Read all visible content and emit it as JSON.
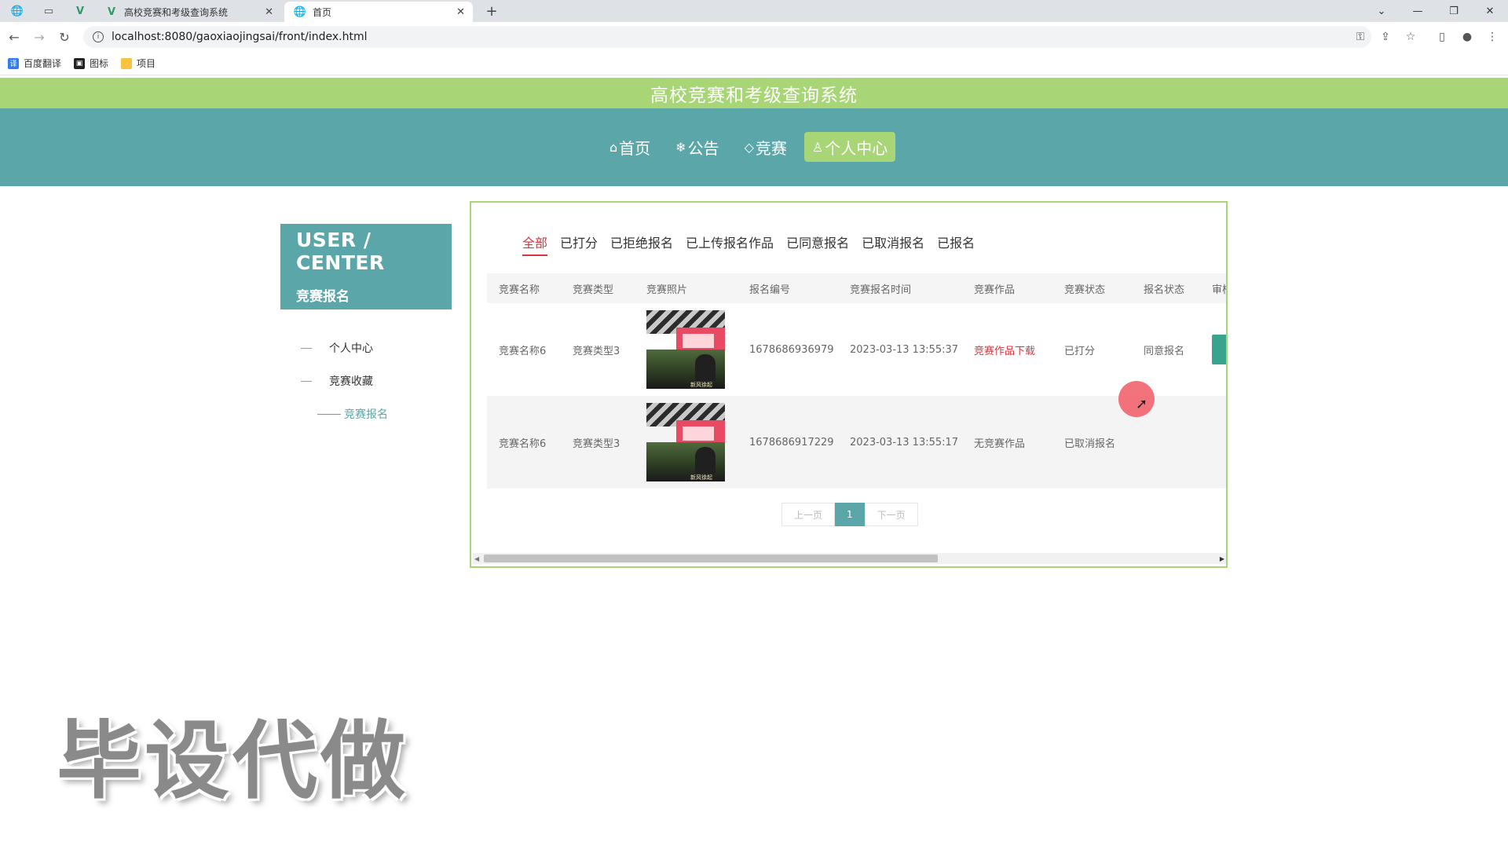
{
  "browser": {
    "tabs": [
      {
        "label": "高校竞赛和考级查询系统",
        "state": "inactive",
        "icon": "vue-logo-icon"
      },
      {
        "label": "首页",
        "state": "active",
        "icon": "globe-icon"
      }
    ],
    "url": "localhost:8080/gaoxiaojingsai/front/index.html",
    "bookmarks": [
      {
        "label": "百度翻译",
        "icon": "translate-icon",
        "color": "#2e7cf6"
      },
      {
        "label": "图标",
        "icon": "image-icon",
        "color": "#222222"
      },
      {
        "label": "项目",
        "icon": "folder-icon",
        "color": "#f6c342"
      }
    ],
    "tab_close_glyph": "✕",
    "new_tab_glyph": "+",
    "window_controls": [
      "⌄",
      "—",
      "❐",
      "✕"
    ]
  },
  "site": {
    "title": "高校竞赛和考级查询系统",
    "nav": [
      {
        "label": "首页",
        "icon": "home-icon",
        "glyph": "⌂",
        "active": false
      },
      {
        "label": "公告",
        "icon": "snowflake-icon",
        "glyph": "❄",
        "active": false
      },
      {
        "label": "竞赛",
        "icon": "tag-icon",
        "glyph": "◇",
        "active": false
      },
      {
        "label": "个人中心",
        "icon": "user-icon",
        "glyph": "♙",
        "active": true
      }
    ],
    "accent": "#5aa6a8",
    "secondary": "#a8d576"
  },
  "sidebar": {
    "title_en": "USER / CENTER",
    "title_cn": "竞赛报名",
    "items": [
      {
        "label": "个人中心",
        "active": false
      },
      {
        "label": "竞赛收藏",
        "active": false
      },
      {
        "label": "竞赛报名",
        "active": true
      }
    ]
  },
  "filters": [
    "全部",
    "已打分",
    "已拒绝报名",
    "已上传报名作品",
    "已同意报名",
    "已取消报名",
    "已报名"
  ],
  "active_filter": "全部",
  "table": {
    "columns": [
      "竞赛名称",
      "竞赛类型",
      "竞赛照片",
      "报名编号",
      "竞赛报名时间",
      "竞赛作品",
      "竞赛状态",
      "报名状态",
      "审核"
    ],
    "rows": [
      {
        "name": "竞赛名称6",
        "type": "竞赛类型3",
        "photo_caption": "新风徐起",
        "code": "1678686936979",
        "time": "2023-03-13 13:55:37",
        "work": "竞赛作品下载",
        "work_is_link": true,
        "status": "已打分",
        "signup_status": "同意报名"
      },
      {
        "name": "竞赛名称6",
        "type": "竞赛类型3",
        "photo_caption": "新风徐起",
        "code": "1678686917229",
        "time": "2023-03-13 13:55:17",
        "work": "无竞赛作品",
        "work_is_link": false,
        "status": "已取消报名",
        "signup_status": ""
      }
    ]
  },
  "pager": {
    "prev": "上一页",
    "current": "1",
    "next": "下一页"
  },
  "watermark": "毕设代做"
}
